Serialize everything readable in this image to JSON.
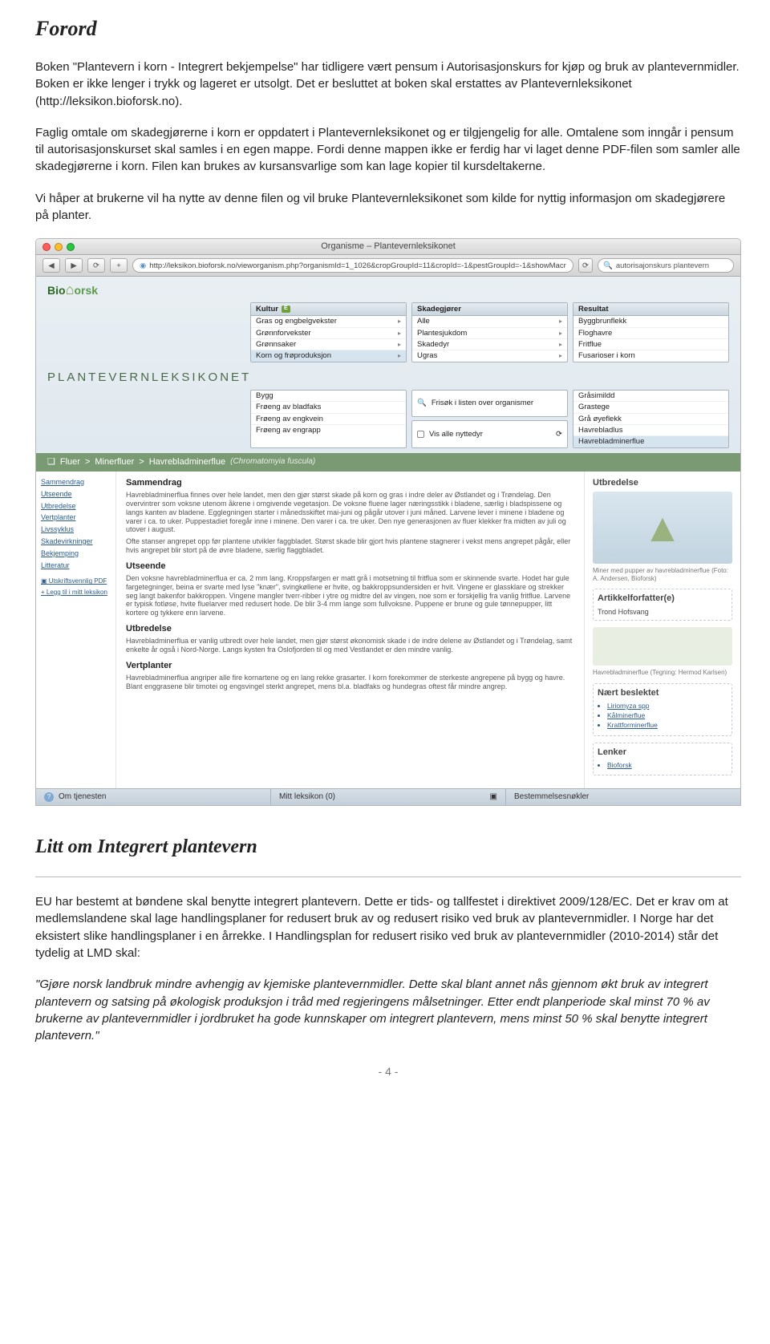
{
  "doc": {
    "h1": "Forord",
    "p1": "Boken \"Plantevern i korn - Integrert bekjempelse\" har tidligere vært pensum i Autorisasjonskurs for kjøp og bruk av plantevernmidler. Boken er ikke lenger i trykk og lageret er utsolgt. Det er besluttet at boken skal erstattes av Plantevernleksikonet (http://leksikon.bioforsk.no).",
    "p2": "Faglig omtale om skadegjørerne i korn er oppdatert i Plantevernleksikonet og er tilgjengelig for alle. Omtalene som inngår i pensum til autorisasjonskurset skal samles i en egen mappe. Fordi denne mappen ikke er ferdig har vi laget denne PDF-filen som samler alle skadegjørerne i korn. Filen kan brukes av kursansvarlige som kan lage kopier til kursdeltakerne.",
    "p3": "Vi håper at brukerne vil ha nytte av denne filen og vil bruke Plantevernleksikonet som kilde for nyttig informasjon om skadegjørere på planter.",
    "h2": "Litt om Integrert plantevern",
    "p4": "EU har bestemt at bøndene skal benytte integrert plantevern. Dette er tids- og tallfestet i direktivet 2009/128/EC. Det er krav om at medlemslandene skal lage handlingsplaner for redusert bruk av og redusert risiko ved bruk av plantevernmidler. I Norge har det eksistert slike handlingsplaner i en årrekke. I Handlingsplan for redusert risiko ved bruk av plantevernmidler (2010-2014) står det tydelig at LMD skal:",
    "p5": "\"Gjøre norsk landbruk mindre avhengig av kjemiske plantevernmidler. Dette skal blant annet nås gjennom økt bruk av integrert plantevern og satsing på økologisk produksjon i tråd med regjeringens målsetninger. Etter endt planperiode skal minst 70 % av brukerne av plantevernmidler i jordbruket ha gode kunnskaper om integrert plantevern, mens minst 50 % skal benytte integrert plantevern.\"",
    "pagefoot": "- 4 -"
  },
  "scr": {
    "title": "Organisme – Plantevernleksikonet",
    "url": "http://leksikon.bioforsk.no/vieworganism.php?organismId=1_1026&cropGroupId=11&cropId=-1&pestGroupId=-1&showMacr",
    "search": "autorisajonskurs plantevern",
    "logo": "Bioforsk",
    "brand": "PLANTEVERNLEKSIKONET",
    "tables": {
      "kultur": {
        "h": "Kultur",
        "badge": "E",
        "rows": [
          "Gras og engbelgvekster",
          "Grønnforvekster",
          "Grønnsaker",
          "Korn og frøproduksjon"
        ]
      },
      "skade": {
        "h": "Skadegjører",
        "rows": [
          "Alle",
          "Plantesjukdom",
          "Skadedyr",
          "Ugras"
        ]
      },
      "resultat": {
        "h": "Resultat",
        "rows": [
          "Byggbrunflekk",
          "Floghavre",
          "Fritflue",
          "Fusarioser i korn",
          "Gråsimildd",
          "Grastege",
          "Grå øyeflekk",
          "Havrebladlus",
          "Havrebladminerflue"
        ]
      }
    },
    "crops": [
      "Bygg",
      "Frøeng av bladfaks",
      "Frøeng av engkvein",
      "Frøeng av engrapp"
    ],
    "filters": {
      "a": "Frisøk i listen over organismer",
      "b": "Vis alle nyttedyr"
    },
    "breadcrumb": {
      "a": "Fluer",
      "b": "Minerfluer",
      "c": "Havrebladminerflue",
      "it": "(Chromatomyia fuscula)"
    },
    "leftnav": [
      "Sammendrag",
      "Utseende",
      "Utbredelse",
      "Vertplanter",
      "Livssyklus",
      "Skadevirkninger",
      "Bekjemping",
      "Litteratur"
    ],
    "leftnav2": [
      "Utskriftsvennlig PDF",
      "Legg til i mitt leksikon"
    ],
    "center": {
      "h1": "Sammendrag",
      "t1": "Havrebladminerflua finnes over hele landet, men den gjør størst skade på korn og gras i indre deler av Østlandet og i Trøndelag. Den overvintrer som voksne utenom åkrene i omgivende vegetasjon. De voksne fluene lager næringsstikk i bladene, særlig i bladspissene og langs kanten av bladene. Egglegningen starter i månedsskiftet mai-juni og pågår utover i juni måned. Larvene lever i minene i bladene og varer i ca. to uker. Puppestadiet foregår inne i minene. Den varer i ca. tre uker. Den nye generasjonen av fluer klekker fra midten av juli og utover i august.",
      "t1b": "Ofte stanser angrepet opp før plantene utvikler faggbladet. Størst skade blir gjort hvis plantene stagnerer i vekst mens angrepet pågår, eller hvis angrepet blir stort på de øvre bladene, særlig flaggbladet.",
      "h2": "Utseende",
      "t2": "Den voksne havrebladminerflua er ca. 2 mm lang. Kroppsfargen er matt grå i motsetning til fritflua som er skinnende svarte. Hodet har gule fargetegninger, beina er svarte med lyse \"knær\", svingkøllene er hvite, og bakkroppsundersiden er hvit. Vingene er glassklare og strekker seg langt bakenfor bakkroppen. Vingene mangler tverr-ribber i ytre og midtre del av vingen, noe som er forskjellig fra vanlig fritflue. Larvene er typisk fotløse, hvite fluelarver med redusert hode. De blir 3-4 mm lange som fullvoksne. Puppene er brune og gule tønnepupper, litt kortere og tykkere enn larvene.",
      "h3": "Utbredelse",
      "t3": "Havrebladminerflua er vanlig utbredt over hele landet, men gjør størst økonomisk skade i de indre delene av Østlandet og i Trøndelag, samt enkelte år også i Nord-Norge. Langs kysten fra Oslofjorden til og med Vestlandet er den mindre vanlig.",
      "h4": "Vertplanter",
      "t4": "Havrebladminerflua angriper alle fire kornartene og en lang rekke grasarter. I korn forekommer de sterkeste angrepene på bygg og havre. Blant enggrasene blir timotei og engsvingel sterkt angrepet, mens bl.a. bladfaks og hundegras oftest får mindre angrep."
    },
    "right": {
      "h1": "Utbredelse",
      "cap1": "Miner med pupper av havrebladminerflue (Foto: A. Andersen, Bioforsk)",
      "h2": "Artikkelforfatter(e)",
      "auth": "Trond Hofsvang",
      "h3": "Nært beslektet",
      "rel": [
        "Liriomyza spp",
        "Kålminerflue",
        "Krattforminerflue"
      ],
      "cap2": "Havrebladminerflue (Tegning: Hermod Karlsen)",
      "h4": "Lenker",
      "lnk": "Bioforsk"
    },
    "bottomtabs": {
      "a": "Om tjenesten",
      "b": "Mitt leksikon (0)",
      "c": "Bestemmelsesnøkler"
    }
  }
}
